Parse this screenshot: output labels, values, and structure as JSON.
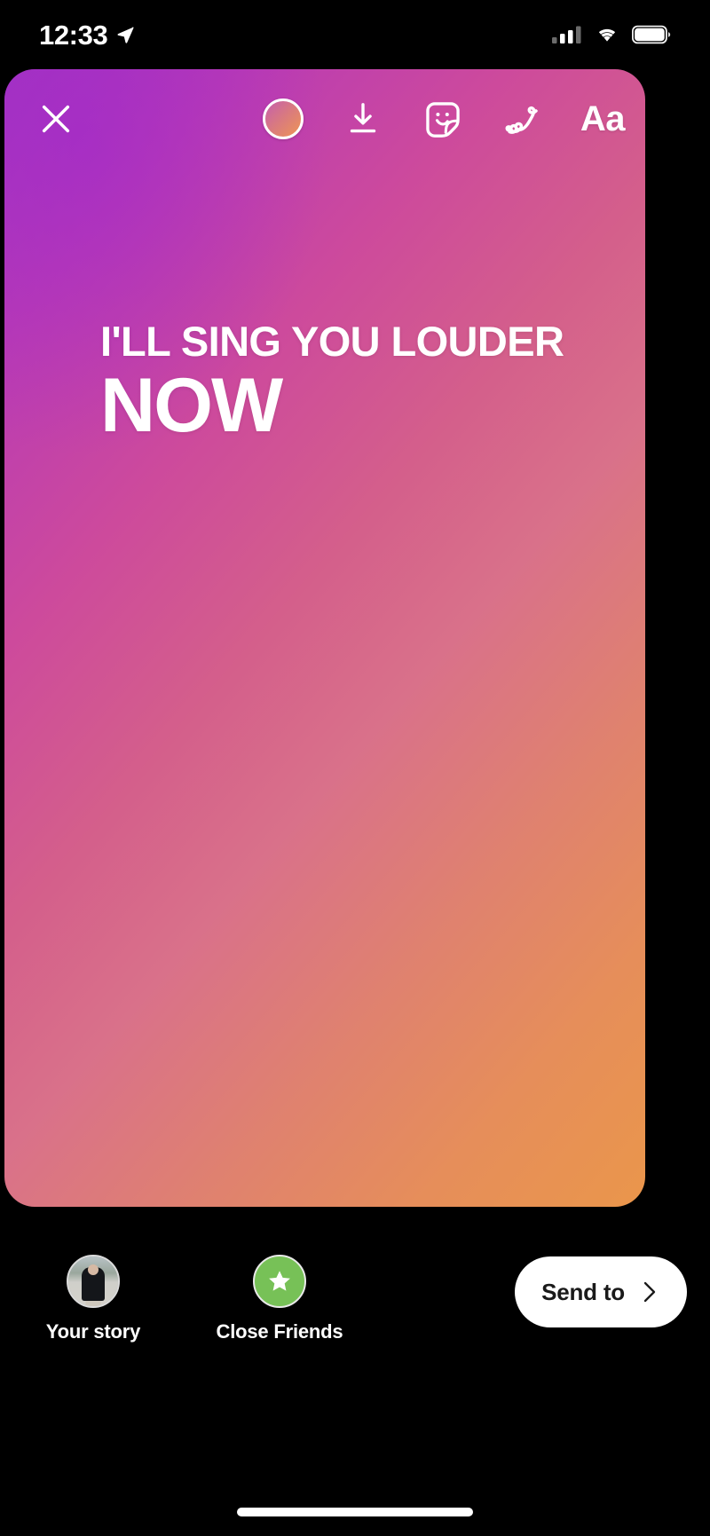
{
  "status_bar": {
    "time": "12:33",
    "location_icon": "location-arrow-icon",
    "signal_icon": "cellular-signal-icon",
    "wifi_icon": "wifi-icon",
    "battery_icon": "battery-full-icon"
  },
  "toolbar": {
    "close_icon": "close-x-icon",
    "items": [
      {
        "name": "effects-gradient-circle",
        "icon": "gradient-circle-icon",
        "label": ""
      },
      {
        "name": "save-download",
        "icon": "download-arrow-icon",
        "label": ""
      },
      {
        "name": "stickers",
        "icon": "sticker-face-icon",
        "label": ""
      },
      {
        "name": "draw",
        "icon": "squiggle-draw-icon",
        "label": ""
      },
      {
        "name": "text",
        "icon": "text-aa-icon",
        "label": "Aa"
      }
    ]
  },
  "story": {
    "text_line_1": "I'LL SING YOU LOUDER",
    "text_line_2": "NOW",
    "background_type": "gradient",
    "gradient_start": "#a435c1",
    "gradient_mid": "#d65f8c",
    "gradient_end": "#ea964b"
  },
  "share_bar": {
    "recipients": [
      {
        "label": "Your story",
        "icon": "avatar",
        "badge_color": ""
      },
      {
        "label": "Close Friends",
        "icon": "star-badge-icon",
        "badge_color": "#77c157"
      }
    ],
    "send_button": {
      "label": "Send to",
      "chevron_icon": "chevron-right-icon"
    }
  },
  "system": {
    "home_indicator": "home-indicator-bar"
  }
}
